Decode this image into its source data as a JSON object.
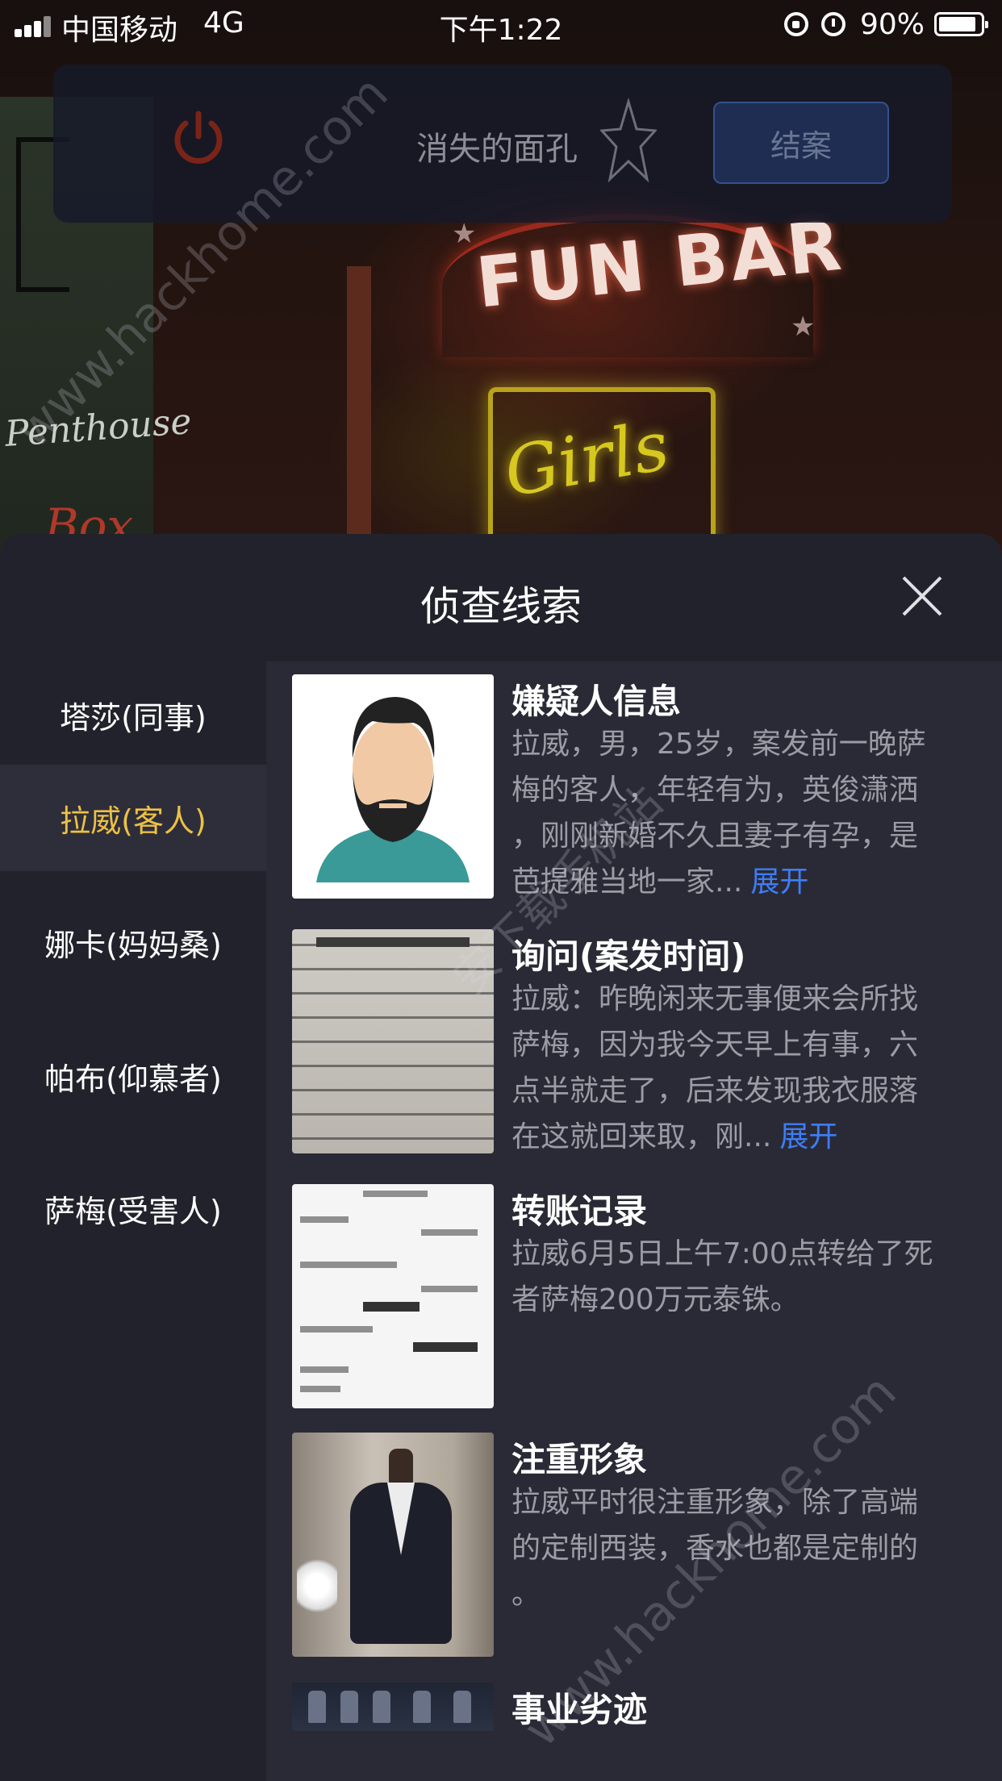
{
  "status_bar": {
    "carrier": "中国移动",
    "network": "4G",
    "time": "下午1:22",
    "battery_percent": "90%",
    "battery_level": 0.9
  },
  "case_header": {
    "title": "消失的面孔",
    "close_case_label": "结案"
  },
  "background_scene": {
    "sign_main": "FUN BAR",
    "sign_sub": "Girls",
    "sign_left": "Penthouse",
    "sign_left_box": "Box"
  },
  "panel": {
    "title": "侦查线索"
  },
  "sidebar": {
    "items": [
      {
        "label": "塔莎(同事)",
        "active": false
      },
      {
        "label": "拉威(客人)",
        "active": true
      },
      {
        "label": "娜卡(妈妈桑)",
        "active": false
      },
      {
        "label": "帕布(仰慕者)",
        "active": false
      },
      {
        "label": "萨梅(受害人)",
        "active": false
      }
    ]
  },
  "clues": [
    {
      "title": "嫌疑人信息",
      "lines": [
        "拉威，男，25岁，案发前一晚萨",
        "梅的客人，年轻有为，英俊潇洒",
        "，刚刚新婚不久且妻子有孕，是",
        "芭提雅当地一家..."
      ],
      "expand": "展开",
      "thumb": "suspect-avatar"
    },
    {
      "title": "询问(案发时间)",
      "lines": [
        "拉威：昨晚闲来无事便来会所找",
        "萨梅，因为我今天早上有事，六",
        "点半就走了，后来发现我衣服落",
        "在这就回来取，刚..."
      ],
      "expand": "展开",
      "thumb": "interrogation-document"
    },
    {
      "title": "转账记录",
      "lines": [
        "拉威6月5日上午7:00点转给了死",
        "者萨梅200万元泰铢。"
      ],
      "expand": "",
      "thumb": "transfer-receipt"
    },
    {
      "title": "注重形象",
      "lines": [
        "拉威平时很注重形象，除了高端",
        "的定制西装，香水也都是定制的",
        "。"
      ],
      "expand": "",
      "thumb": "suit-photo"
    },
    {
      "title": "事业劣迹",
      "lines": [],
      "expand": "",
      "thumb": "bar-photo"
    }
  ],
  "watermarks": {
    "site": "www.hackhome.com",
    "cn": "安下载手机站"
  },
  "colors": {
    "panel_bg": "#22222c",
    "content_bg": "#2a2a36",
    "active_text": "#ecc145",
    "expand_link": "#3f7df5",
    "button_bg": "#1f2d52"
  }
}
